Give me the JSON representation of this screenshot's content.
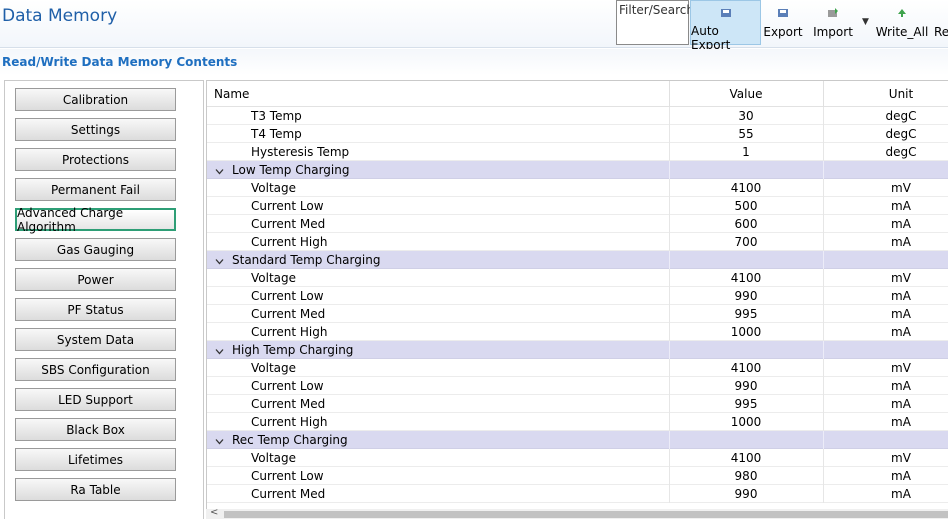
{
  "header": {
    "title": "Data Memory",
    "filter_placeholder": "Filter/Search",
    "toolbar": [
      {
        "label": "Auto Export",
        "icon": "auto-export-icon",
        "active": true
      },
      {
        "label": "Export",
        "icon": "export-icon",
        "active": false
      },
      {
        "label": "Import",
        "icon": "import-icon",
        "active": false
      },
      {
        "label": "Write_All",
        "icon": "write-all-icon",
        "active": false
      },
      {
        "label": "Re",
        "icon": "",
        "active": false
      }
    ]
  },
  "section_title": "Read/Write Data Memory Contents",
  "categories": [
    "Calibration",
    "Settings",
    "Protections",
    "Permanent Fail",
    "Advanced Charge Algorithm",
    "Gas Gauging",
    "Power",
    "PF Status",
    "System Data",
    "SBS Configuration",
    "LED Support",
    "Black Box",
    "Lifetimes",
    "Ra Table"
  ],
  "selected_category": "Advanced Charge Algorithm",
  "table": {
    "columns": {
      "name": "Name",
      "value": "Value",
      "unit": "Unit"
    },
    "rows": [
      {
        "type": "item",
        "name": "T3 Temp",
        "value": "30",
        "unit": "degC"
      },
      {
        "type": "item",
        "name": "T4 Temp",
        "value": "55",
        "unit": "degC"
      },
      {
        "type": "item",
        "name": "Hysteresis Temp",
        "value": "1",
        "unit": "degC"
      },
      {
        "type": "group",
        "name": "Low Temp Charging"
      },
      {
        "type": "item",
        "name": "Voltage",
        "value": "4100",
        "unit": "mV"
      },
      {
        "type": "item",
        "name": "Current Low",
        "value": "500",
        "unit": "mA"
      },
      {
        "type": "item",
        "name": "Current Med",
        "value": "600",
        "unit": "mA"
      },
      {
        "type": "item",
        "name": "Current High",
        "value": "700",
        "unit": "mA"
      },
      {
        "type": "group",
        "name": "Standard Temp Charging"
      },
      {
        "type": "item",
        "name": "Voltage",
        "value": "4100",
        "unit": "mV"
      },
      {
        "type": "item",
        "name": "Current Low",
        "value": "990",
        "unit": "mA"
      },
      {
        "type": "item",
        "name": "Current Med",
        "value": "995",
        "unit": "mA"
      },
      {
        "type": "item",
        "name": "Current High",
        "value": "1000",
        "unit": "mA"
      },
      {
        "type": "group",
        "name": "High Temp Charging"
      },
      {
        "type": "item",
        "name": "Voltage",
        "value": "4100",
        "unit": "mV"
      },
      {
        "type": "item",
        "name": "Current Low",
        "value": "990",
        "unit": "mA"
      },
      {
        "type": "item",
        "name": "Current Med",
        "value": "995",
        "unit": "mA"
      },
      {
        "type": "item",
        "name": "Current High",
        "value": "1000",
        "unit": "mA"
      },
      {
        "type": "group",
        "name": "Rec Temp Charging"
      },
      {
        "type": "item",
        "name": "Voltage",
        "value": "4100",
        "unit": "mV"
      },
      {
        "type": "item",
        "name": "Current Low",
        "value": "980",
        "unit": "mA"
      },
      {
        "type": "item",
        "name": "Current Med",
        "value": "990",
        "unit": "mA"
      }
    ]
  },
  "colors": {
    "accent": "#1f6fc0",
    "group_row": "#d9d9f0",
    "selected_border": "#2e9e76"
  }
}
